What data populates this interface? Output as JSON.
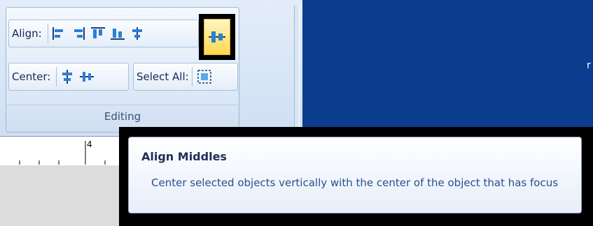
{
  "ribbon": {
    "align_label": "Align:",
    "center_label": "Center:",
    "select_all_label": "Select All:",
    "group_title": "Editing",
    "align_buttons": [
      "align-lefts",
      "align-rights",
      "align-tops",
      "align-bottoms",
      "align-centers",
      "align-middles"
    ],
    "center_buttons": [
      "center-horizontally",
      "center-vertically"
    ]
  },
  "ruler": {
    "mark": "4"
  },
  "tooltip": {
    "title": "Align Middles",
    "body": "Center selected objects vertically with the center of the object that has focus"
  },
  "edge_text": "r",
  "colors": {
    "highlight_frame": "#000000",
    "selected_button": "#ffd84f",
    "blue_area": "#0b3d8f",
    "label_text": "#15295a",
    "tooltip_body": "#26508f"
  }
}
